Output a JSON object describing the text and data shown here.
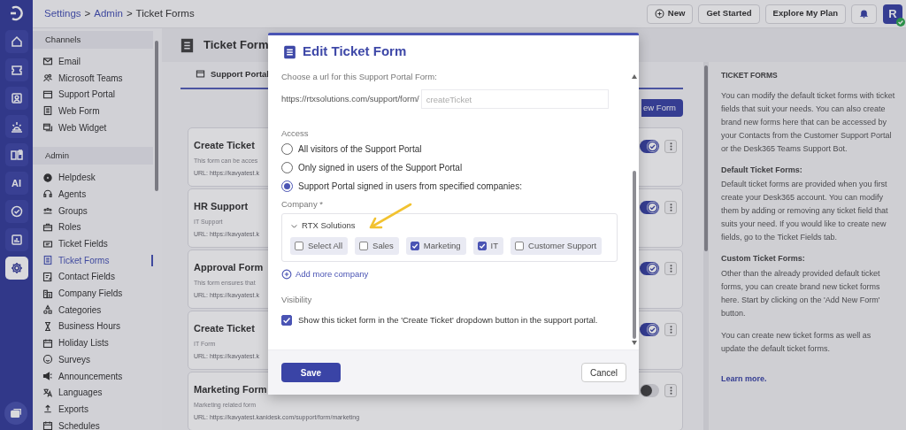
{
  "rail": {
    "items": [
      {
        "kind": "home",
        "selected": false
      },
      {
        "kind": "ticket",
        "selected": false
      },
      {
        "kind": "contact",
        "selected": false
      },
      {
        "kind": "sunrise",
        "selected": false
      },
      {
        "kind": "book",
        "selected": false
      },
      {
        "kind": "ai",
        "label": "AI",
        "selected": false
      },
      {
        "kind": "check",
        "selected": false
      },
      {
        "kind": "chart",
        "selected": false
      },
      {
        "kind": "settings",
        "selected": true
      }
    ]
  },
  "breadcrumb": [
    {
      "kind": "link",
      "label": "Settings"
    },
    {
      "kind": "separator",
      "label": ">"
    },
    {
      "kind": "link",
      "label": "Admin"
    },
    {
      "kind": "separator",
      "label": ">"
    },
    {
      "kind": "current",
      "label": "Ticket Forms"
    }
  ],
  "top_buttons": [
    {
      "kind": "add",
      "label": "New"
    },
    {
      "kind": "plain",
      "label": "Get Started"
    },
    {
      "kind": "plain",
      "label": "Explore My Plan"
    }
  ],
  "avatar": {
    "initial": "R",
    "online": true
  },
  "sidebar": {
    "sections": [
      {
        "title": "Channels",
        "items": [
          {
            "kind": "email",
            "label": "Email",
            "selected": false
          },
          {
            "kind": "teams",
            "label": "Microsoft Teams",
            "selected": false
          },
          {
            "kind": "portal",
            "label": "Support Portal",
            "selected": false
          },
          {
            "kind": "webform",
            "label": "Web Form",
            "selected": false
          },
          {
            "kind": "widget",
            "label": "Web Widget",
            "selected": false
          }
        ]
      },
      {
        "title": "Admin",
        "items": [
          {
            "kind": "helpdesk",
            "label": "Helpdesk",
            "selected": false
          },
          {
            "kind": "agents",
            "label": "Agents",
            "selected": false
          },
          {
            "kind": "groups",
            "label": "Groups",
            "selected": false
          },
          {
            "kind": "roles",
            "label": "Roles",
            "selected": false
          },
          {
            "kind": "fields",
            "label": "Ticket Fields",
            "selected": false
          },
          {
            "kind": "webform",
            "label": "Ticket Forms",
            "selected": true
          },
          {
            "kind": "contact_fields",
            "label": "Contact Fields",
            "selected": false
          },
          {
            "kind": "company",
            "label": "Company Fields",
            "selected": false
          },
          {
            "kind": "categories",
            "label": "Categories",
            "selected": false
          },
          {
            "kind": "hours",
            "label": "Business Hours",
            "selected": false
          },
          {
            "kind": "calendar",
            "label": "Holiday Lists",
            "selected": false
          },
          {
            "kind": "smiley",
            "label": "Surveys",
            "selected": false
          },
          {
            "kind": "megaphone",
            "label": "Announcements",
            "selected": false
          },
          {
            "kind": "translate",
            "label": "Languages",
            "selected": false
          },
          {
            "kind": "upload",
            "label": "Exports",
            "selected": false
          },
          {
            "kind": "calendar",
            "label": "Schedules",
            "selected": false
          }
        ]
      }
    ]
  },
  "page": {
    "title": "Ticket Form",
    "tabs": [
      {
        "label": "Support Portal",
        "selected": true
      }
    ],
    "add_button": "ew Form",
    "forms": [
      {
        "title": "Create Ticket",
        "description": "This form can be acces",
        "url": "URL: https://kavyatest.k",
        "enabled": true
      },
      {
        "title": "HR Support",
        "description": "IT Support",
        "url": "URL: https://kavyatest.k",
        "enabled": true
      },
      {
        "title": "Approval Form",
        "description": "This form ensures that",
        "url": "URL: https://kavyatest.k",
        "enabled": true
      },
      {
        "title": "Create Ticket",
        "description": "IT Form",
        "url": "URL: https://kavyatest.k",
        "enabled": true
      },
      {
        "title": "Marketing Form",
        "description": "Marketing related form",
        "url": "URL: https://kavyatest.kanidesk.com/support/form/marketing",
        "enabled": false
      }
    ]
  },
  "info_panel": {
    "blocks": [
      {
        "kind": "title",
        "text": "TICKET FORMS"
      },
      {
        "kind": "text",
        "text": "You can modify the default ticket forms with ticket fields that suit your needs. You can also create brand new forms here that can be accessed by your Contacts from the Customer Support Portal or the Desk365 Teams Support Bot."
      },
      {
        "kind": "heading",
        "text": "Default Ticket Forms:"
      },
      {
        "kind": "text",
        "text": "Default ticket forms are provided when you first create your Desk365 account. You can modify them by adding or removing any ticket field that suits your need. If you would like to create new fields, go to the Ticket Fields tab."
      },
      {
        "kind": "heading",
        "text": "Custom Ticket Forms:"
      },
      {
        "kind": "text",
        "text": "Other than the already provided default ticket forms, you can create brand new ticket forms here. Start by clicking on the 'Add New Form' button."
      },
      {
        "kind": "text",
        "text": "You can create new ticket forms as well as update the default ticket forms."
      },
      {
        "kind": "link",
        "text": "Learn more."
      }
    ]
  },
  "modal": {
    "title": "Edit Ticket Form",
    "url_prompt": "Choose a url for this Support Portal Form:",
    "url_prefix": "https://rtxsolutions.com/support/form/",
    "slug_placeholder": "createTicket",
    "access_label": "Access",
    "access_options": [
      {
        "label": "All visitors of the Support Portal",
        "selected": false
      },
      {
        "label": "Only signed in users of the Support Portal",
        "selected": false
      },
      {
        "label": "Support Portal signed in users from specified companies:",
        "selected": true
      }
    ],
    "company_label": "Company *",
    "companies": [
      {
        "name": "RTX Solutions",
        "expanded": true,
        "departments": [
          {
            "label": "Select All",
            "checked": false
          },
          {
            "label": "Sales",
            "checked": false
          },
          {
            "label": "Marketing",
            "checked": true
          },
          {
            "label": "IT",
            "checked": true
          },
          {
            "label": "Customer Support",
            "checked": false
          }
        ]
      }
    ],
    "add_company": "Add more company",
    "visibility_label": "Visibility",
    "visibility_option": {
      "label": "Show this ticket form in the 'Create Ticket' dropdown button in the support portal.",
      "checked": true
    },
    "save": "Save",
    "cancel": "Cancel"
  }
}
